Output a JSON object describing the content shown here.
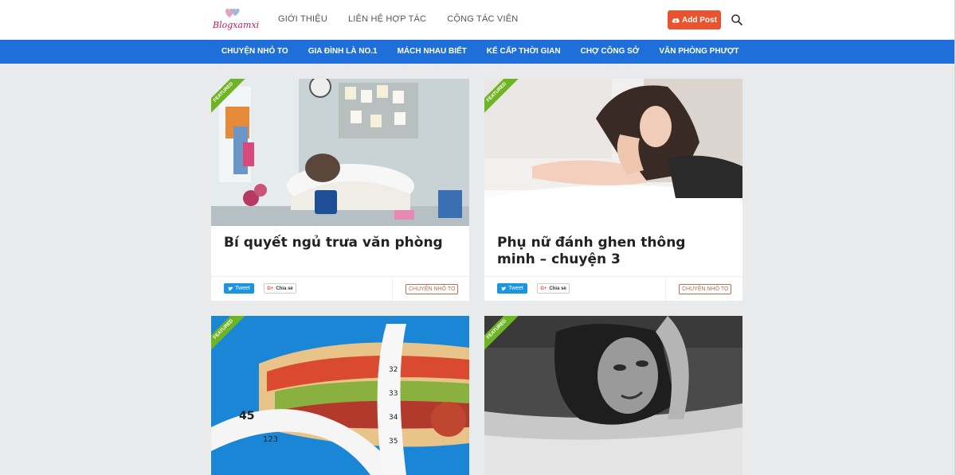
{
  "header": {
    "logo_text": "Blogxamxi",
    "nav": [
      "GIỚI THIỆU",
      "LIÊN HỆ HỢP TÁC",
      "CỘNG TÁC VIÊN"
    ],
    "add_post_label": "Add Post",
    "search_icon": "search-icon"
  },
  "categories": [
    "CHUYỆN NHỎ TO",
    "GIA ĐÌNH LÀ NO.1",
    "MÁCH NHAU BIẾT",
    "KỂ CẤP THỜI GIAN",
    "CHỢ CÔNG SỞ",
    "VĂN PHÒNG PHƯỢT"
  ],
  "colors": {
    "brand_blue": "#1e6fd9",
    "accent_orange": "#e8542f",
    "ribbon_green": "#6fb424"
  },
  "posts": [
    {
      "badge": "FEATURED",
      "title": "Bí quyết ngủ trưa văn phòng",
      "tweet_label": "Tweet",
      "share_label": "Chia sẻ",
      "category": "CHUYỆN NHỎ TO"
    },
    {
      "badge": "FEATURED",
      "title": "Phụ nữ đánh ghen thông minh – chuyện 3",
      "tweet_label": "Tweet",
      "share_label": "Chia sẻ",
      "category": "CHUYỆN NHỎ TO"
    },
    {
      "badge": "FEATURED"
    },
    {
      "badge": "FEATURED"
    }
  ]
}
